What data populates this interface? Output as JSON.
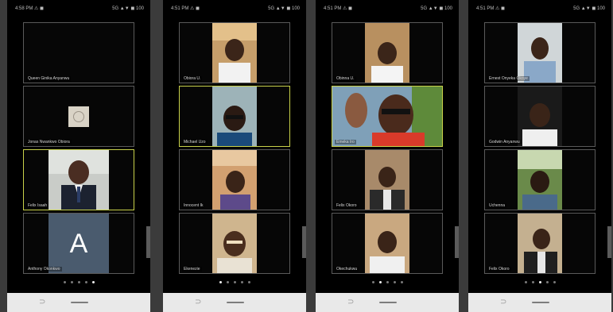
{
  "status_bar": {
    "right": "5G ▲▼ ◼ 100"
  },
  "pager": {
    "dots_total": 5
  },
  "colors": {
    "active_speaker_border": "#c9d24a",
    "tile_border": "#5a5a5a",
    "nav_bar": "#e9e9e9",
    "avatar_bg": "#4a5b6e"
  },
  "icons": {
    "back": "back-icon",
    "home": "home-bar-icon",
    "camera_off": "camera-off-icon"
  },
  "phones": [
    {
      "time": "4:58 PM ⚠ ◼",
      "active_dot": 4,
      "tiles": [
        {
          "name": "Queen Ginika Anyanwu",
          "type": "blank"
        },
        {
          "name": "Jonas Nwankwo Obiora",
          "type": "logo"
        },
        {
          "name": "Felix Isaah",
          "type": "video",
          "active": true
        },
        {
          "name": "Anthony Okonkwo",
          "type": "letter",
          "letter": "A"
        }
      ]
    },
    {
      "time": "4:51 PM ⚠ ◼",
      "active_dot": 1,
      "tiles": [
        {
          "name": "Obiora U.",
          "type": "video"
        },
        {
          "name": "Michael Uzo",
          "type": "video",
          "active": true
        },
        {
          "name": "Innocent Ik",
          "type": "video"
        },
        {
          "name": "Ekenezie",
          "type": "video"
        }
      ]
    },
    {
      "time": "4:51 PM ⚠ ◼",
      "active_dot": 2,
      "tiles": [
        {
          "name": "Obinna U.",
          "type": "video"
        },
        {
          "name": "Emeka Iro",
          "type": "video",
          "active": true,
          "wide": true
        },
        {
          "name": "Felix Okoro",
          "type": "video"
        },
        {
          "name": "Okechukwu",
          "type": "video"
        }
      ]
    },
    {
      "time": "4:51 PM ⚠ ◼",
      "active_dot": 3,
      "tiles": [
        {
          "name": "Ernest Onyeka Okoye",
          "type": "video"
        },
        {
          "name": "Godwin Anyanwu",
          "type": "video"
        },
        {
          "name": "Uchenna",
          "type": "video"
        },
        {
          "name": "Felix Okoro",
          "type": "video"
        }
      ]
    }
  ]
}
